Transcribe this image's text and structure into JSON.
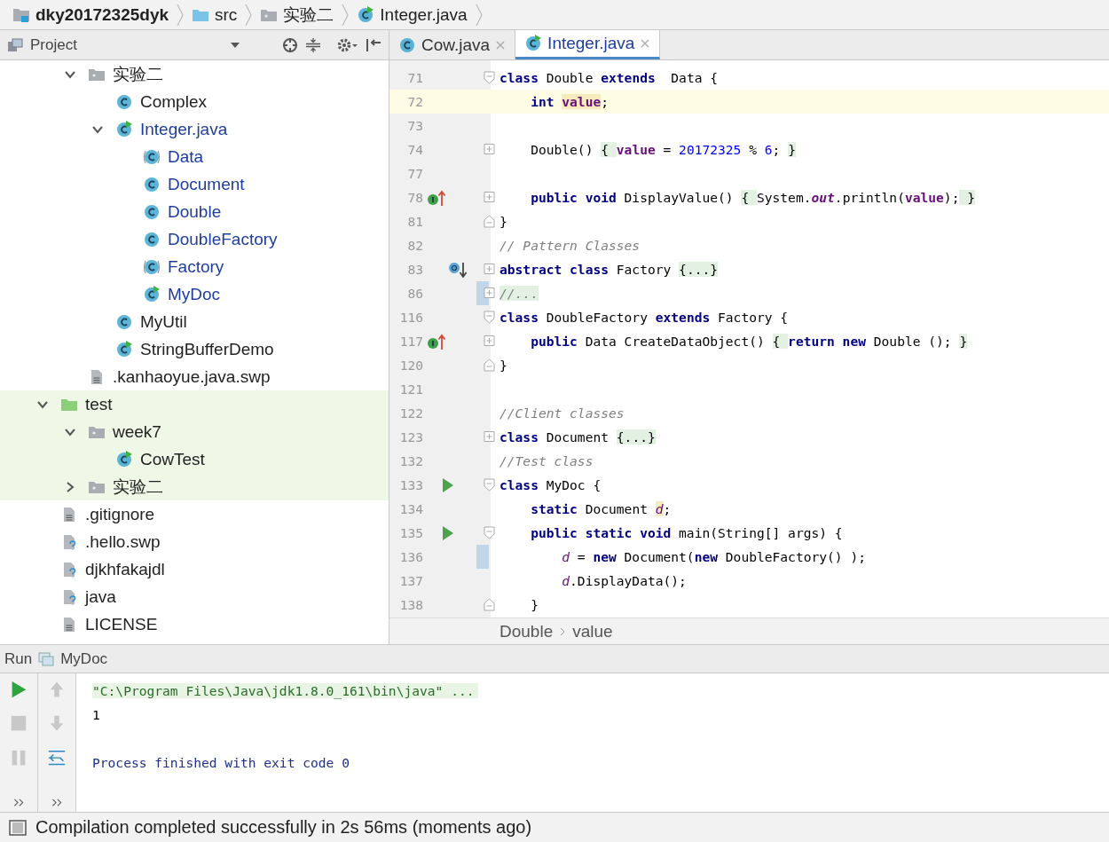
{
  "nav_bar": {
    "crumbs": [
      {
        "label": "dky20172325dyk",
        "kind": "module",
        "bold": true
      },
      {
        "label": "src",
        "kind": "source-folder",
        "bold": false
      },
      {
        "label": "实验二",
        "kind": "folder",
        "bold": false
      },
      {
        "label": "Integer.java",
        "kind": "class-run",
        "bold": false
      }
    ]
  },
  "project_panel": {
    "title": "Project",
    "tree": [
      {
        "children": [
          {
            "label": "实验二",
            "kind": "folder",
            "expanded": true,
            "modified": false,
            "children": [
              {
                "label": "Complex",
                "kind": "class",
                "modified": false
              },
              {
                "label": "Integer.java",
                "kind": "class-run",
                "expanded": true,
                "modified": true,
                "children": [
                  {
                    "label": "Data",
                    "kind": "abstract",
                    "modified": true
                  },
                  {
                    "label": "Document",
                    "kind": "class",
                    "modified": true
                  },
                  {
                    "label": "Double",
                    "kind": "class",
                    "modified": true
                  },
                  {
                    "label": "DoubleFactory",
                    "kind": "class",
                    "modified": true
                  },
                  {
                    "label": "Factory",
                    "kind": "abstract",
                    "modified": true
                  },
                  {
                    "label": "MyDoc",
                    "kind": "class-run",
                    "modified": true
                  }
                ]
              },
              {
                "label": "MyUtil",
                "kind": "class",
                "modified": false
              },
              {
                "label": "StringBufferDemo",
                "kind": "class-run",
                "modified": false
              }
            ]
          },
          {
            "label": ".kanhaoyue.java.swp",
            "kind": "text-file",
            "modified": false
          }
        ]
      },
      {
        "label": "test",
        "kind": "test-folder",
        "expanded": true,
        "modified": false,
        "children": [
          {
            "label": "week7",
            "kind": "folder",
            "expanded": true,
            "modified": false,
            "children": [
              {
                "label": "CowTest",
                "kind": "class-run",
                "modified": false
              }
            ]
          },
          {
            "label": "实验二",
            "kind": "folder",
            "expanded": false,
            "modified": false
          }
        ]
      },
      {
        "label": ".gitignore",
        "kind": "text-file",
        "modified": false
      },
      {
        "label": ".hello.swp",
        "kind": "unknown-file",
        "modified": false
      },
      {
        "label": "djkhfakajdl",
        "kind": "unknown-file",
        "modified": false
      },
      {
        "label": "java",
        "kind": "unknown-file",
        "modified": false
      },
      {
        "label": "LICENSE",
        "kind": "text-file",
        "modified": false
      }
    ]
  },
  "editor": {
    "tabs": [
      {
        "label": "Cow.java",
        "kind": "class",
        "selected": false
      },
      {
        "label": "Integer.java",
        "kind": "class-run",
        "selected": true
      }
    ],
    "lines": [
      {
        "number": "71",
        "fold": {
          "kind": "open"
        },
        "tokens": [
          {
            "kind": "kw",
            "text": "class"
          },
          {
            "kind": "p",
            "text": " Double "
          },
          {
            "kind": "kw",
            "text": "extends"
          },
          {
            "kind": "p",
            "text": "  Data {"
          }
        ]
      },
      {
        "number": "72",
        "caret": true,
        "tokens": [
          {
            "kind": "kw",
            "text": "    int "
          },
          {
            "kind": "fldhl",
            "text": "value"
          },
          {
            "kind": "p",
            "text": ";"
          }
        ]
      },
      {
        "number": "73"
      },
      {
        "number": "74",
        "fold": {
          "kind": "collapsed"
        },
        "tokens": [
          {
            "kind": "p",
            "text": "    Double() "
          },
          {
            "kind": "fold",
            "text": "{ "
          },
          {
            "kind": "fld",
            "text": "value"
          },
          {
            "kind": "p",
            "text": " = "
          },
          {
            "kind": "num",
            "text": "20172325"
          },
          {
            "kind": "p",
            "text": " % "
          },
          {
            "kind": "num",
            "text": "6"
          },
          {
            "kind": "p",
            "text": "; "
          },
          {
            "kind": "fold",
            "text": "}"
          }
        ]
      },
      {
        "number": "77"
      },
      {
        "number": "78",
        "marker": {
          "kind": "implements"
        },
        "fold": {
          "kind": "collapsed"
        },
        "tokens": [
          {
            "kind": "kw",
            "text": "    public void"
          },
          {
            "kind": "p",
            "text": " DisplayValue() "
          },
          {
            "kind": "fold",
            "text": "{ "
          },
          {
            "kind": "p",
            "text": "System."
          },
          {
            "kind": "stat",
            "text": "out"
          },
          {
            "kind": "p",
            "text": ".println("
          },
          {
            "kind": "fld",
            "text": "value"
          },
          {
            "kind": "p",
            "text": ");"
          },
          {
            "kind": "fold",
            "text": " }"
          }
        ]
      },
      {
        "number": "81",
        "fold": {
          "kind": "close"
        },
        "tokens": [
          {
            "kind": "p",
            "text": "}"
          }
        ]
      },
      {
        "number": "82",
        "tokens": [
          {
            "kind": "cm",
            "text": "// Pattern Classes"
          }
        ]
      },
      {
        "number": "83",
        "marker": {
          "kind": "overridden"
        },
        "fold": {
          "kind": "collapsed"
        },
        "tokens": [
          {
            "kind": "kw",
            "text": "abstract class"
          },
          {
            "kind": "p",
            "text": " Factory "
          },
          {
            "kind": "fold",
            "text": "{...}"
          }
        ]
      },
      {
        "number": "86",
        "changed": true,
        "fold": {
          "kind": "collapsed"
        },
        "tokens": [
          {
            "kind": "foldcm",
            "text": "//..."
          }
        ]
      },
      {
        "number": "116",
        "fold": {
          "kind": "open"
        },
        "tokens": [
          {
            "kind": "kw",
            "text": "class"
          },
          {
            "kind": "p",
            "text": " DoubleFactory "
          },
          {
            "kind": "kw",
            "text": "extends"
          },
          {
            "kind": "p",
            "text": " Factory {"
          }
        ]
      },
      {
        "number": "117",
        "marker": {
          "kind": "implements"
        },
        "fold": {
          "kind": "collapsed"
        },
        "tokens": [
          {
            "kind": "kw",
            "text": "    public"
          },
          {
            "kind": "p",
            "text": " Data CreateDataObject() "
          },
          {
            "kind": "fold",
            "text": "{ "
          },
          {
            "kind": "kw",
            "text": "return new"
          },
          {
            "kind": "p",
            "text": " Double (); "
          },
          {
            "kind": "fold",
            "text": "}"
          }
        ]
      },
      {
        "number": "120",
        "fold": {
          "kind": "close"
        },
        "tokens": [
          {
            "kind": "p",
            "text": "}"
          }
        ]
      },
      {
        "number": "121"
      },
      {
        "number": "122",
        "tokens": [
          {
            "kind": "cm",
            "text": "//Client classes"
          }
        ]
      },
      {
        "number": "123",
        "fold": {
          "kind": "collapsed"
        },
        "tokens": [
          {
            "kind": "kw",
            "text": "class"
          },
          {
            "kind": "p",
            "text": " Document "
          },
          {
            "kind": "fold",
            "text": "{...}"
          }
        ]
      },
      {
        "number": "132",
        "tokens": [
          {
            "kind": "cm",
            "text": "//Test class"
          }
        ]
      },
      {
        "number": "133",
        "marker": {
          "kind": "run"
        },
        "fold": {
          "kind": "open"
        },
        "tokens": [
          {
            "kind": "kw",
            "text": "class"
          },
          {
            "kind": "p",
            "text": " MyDoc {"
          }
        ]
      },
      {
        "number": "134",
        "tokens": [
          {
            "kind": "kw",
            "text": "    static"
          },
          {
            "kind": "p",
            "text": " Document "
          },
          {
            "kind": "sfldhl",
            "text": "d"
          },
          {
            "kind": "p",
            "text": ";"
          }
        ]
      },
      {
        "number": "135",
        "marker": {
          "kind": "run"
        },
        "fold": {
          "kind": "open"
        },
        "tokens": [
          {
            "kind": "kw",
            "text": "    public static void"
          },
          {
            "kind": "p",
            "text": " main(String[] args) {"
          }
        ]
      },
      {
        "number": "136",
        "changed": true,
        "tokens": [
          {
            "kind": "sfld",
            "text": "        d"
          },
          {
            "kind": "p",
            "text": " = "
          },
          {
            "kind": "kw",
            "text": "new"
          },
          {
            "kind": "p",
            "text": " Document("
          },
          {
            "kind": "kw",
            "text": "new"
          },
          {
            "kind": "p",
            "text": " DoubleFactory() );"
          }
        ]
      },
      {
        "number": "137",
        "tokens": [
          {
            "kind": "sfld",
            "text": "        d"
          },
          {
            "kind": "p",
            "text": ".DisplayData();"
          }
        ]
      },
      {
        "number": "138",
        "fold": {
          "kind": "close"
        },
        "tokens": [
          {
            "kind": "p",
            "text": "    }"
          }
        ]
      }
    ],
    "breadcrumb": [
      "Double",
      "value"
    ]
  },
  "run_panel": {
    "label": "Run",
    "config": "MyDoc",
    "output": [
      {
        "kind": "command",
        "text": "\"C:\\Program Files\\Java\\jdk1.8.0_161\\bin\\java\" ..."
      },
      {
        "kind": "stdout",
        "text": "1"
      },
      {
        "kind": "blank"
      },
      {
        "kind": "exit",
        "text": "Process finished with exit code 0"
      }
    ]
  },
  "status_bar": {
    "message": "Compilation completed successfully in 2s 56ms (moments ago)"
  }
}
